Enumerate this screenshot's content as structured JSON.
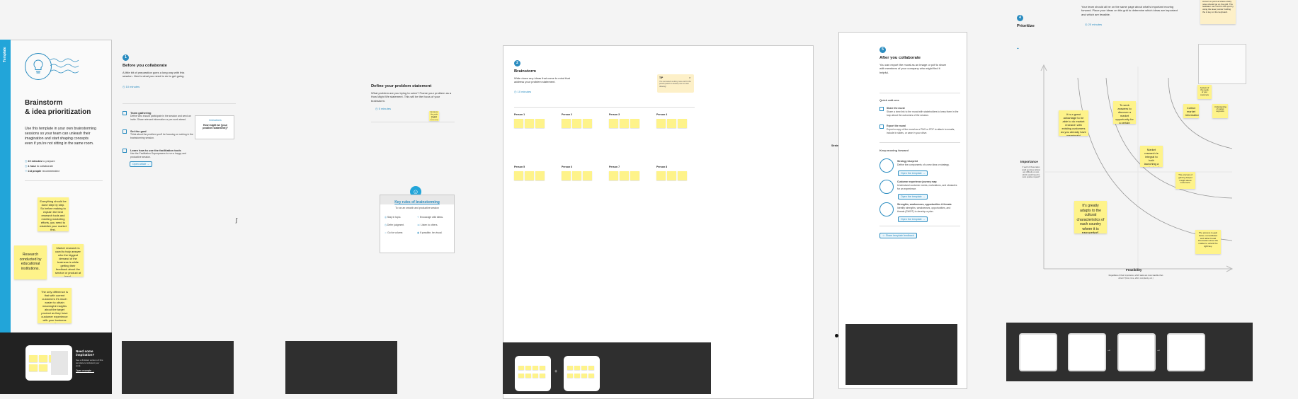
{
  "sidebar": {
    "tab_label": "Template",
    "title_line1": "Brainstorm",
    "title_line2": "& idea prioritization",
    "description": "Use this template in your own brainstorming sessions so your team can unleash their imagination and start shaping concepts even if you're not sitting in the same room.",
    "meta": [
      {
        "bold": "10 minutes",
        "rest": " to prepare"
      },
      {
        "bold": "1 hour",
        "rest": " to collaborate"
      },
      {
        "bold": "2-8 people",
        "rest": " recommended"
      }
    ],
    "stickies": [
      "Everything should be done step by step. So before making to explain the best research tools and meeting marketing efforts, you need to establish your market first.",
      "Research conducted by educational institutions.",
      "Market research is used to truly answer who the biggest demand of the business is while getting their feedback about the service or product at hand.",
      "The only difference is that with current customers it's much easier to obtain meaningful insights about the target product as they have customer experience with your business operations."
    ],
    "inspiration": {
      "title": "Need some inspiration?",
      "body": "See a finished version of this template to kickstart your work.",
      "button": "Open example"
    }
  },
  "step1": {
    "badge": "1",
    "title": "Before you collaborate",
    "body": "A little bit of preparation goes a long way with this session. Here's what you need to do to get going.",
    "time": "10 minutes",
    "items": [
      {
        "title": "Team gathering",
        "body": "Define who should participate in the session and send an invite. Share relevant information or pre-work ahead."
      },
      {
        "title": "Set the goal",
        "body": "Think about the problem you'll be focusing on solving in the brainstorming session."
      },
      {
        "title": "Learn how to use the facilitation tools",
        "body": "Use the Facilitation Superpowers to run a happy and productive session."
      }
    ],
    "open_article": "Open article",
    "card_label": "Instructions",
    "card_text": "How might we [your problem statement]?"
  },
  "step2": {
    "title": "Define your problem statement",
    "body": "What problem are you trying to solve? Frame your problem as a How Might We statement. This will be the focus of your brainstorm.",
    "time": "5 minutes",
    "sticky": "PROBLEM: How might we [your problem statement]?"
  },
  "rules": {
    "title": "Key rules of brainstorming",
    "subtitle": "To run an smooth and productive session",
    "items": [
      "Stay in topic.",
      "Defer judgment.",
      "Go for volume.",
      "Encourage wild ideas.",
      "Listen to others.",
      "If possible, be visual."
    ]
  },
  "brainstorm": {
    "badge": "2",
    "title": "Brainstorm",
    "body": "Write down any ideas that come to mind that address your problem statement.",
    "time": "10 minutes",
    "tip_label": "TIP",
    "tip_body": "You can select a sticky note and hit the pencil (switch to sketch) icon to start drawing!",
    "persons": [
      "Person 1",
      "Person 2",
      "Person 3",
      "Person 4",
      "Person 5",
      "Person 6",
      "Person 7",
      "Person 8"
    ]
  },
  "after": {
    "badge": "5",
    "title": "After you collaborate",
    "body": "You can export the mural as an image or pdf to share with members of your company who might find it helpful.",
    "quick_addons": "Quick add-ons",
    "addons": [
      {
        "title": "Share the mural",
        "body": "Share a view link to the mural with stakeholders to keep them in the loop about the outcomes of the session."
      },
      {
        "title": "Export the mural",
        "body": "Export a copy of the mural as a PNG or PDF to attach to emails, include in slides, or save in your drive."
      }
    ],
    "keep_moving": "Keep moving forward",
    "templates": [
      {
        "title": "Strategy blueprint",
        "body": "Define the components of a new idea or strategy.",
        "link": "Open the template"
      },
      {
        "title": "Customer experience journey map",
        "body": "Understand customer needs, motivations, and obstacles for an experience.",
        "link": "Open the template"
      },
      {
        "title": "Strengths, weaknesses, opportunities & threats",
        "body": "Identify strengths, weaknesses, opportunities, and threats (SWOT) to develop a plan.",
        "link": "Open the template"
      }
    ],
    "share_feedback": "Share template feedback",
    "strategy_label": "Strategy blueprint"
  },
  "prioritize": {
    "badge": "4",
    "title": "Prioritize",
    "intro": "Your team should all be on the same page about what's important moving forward. Place your ideas on this grid to determine which ideas are important and which are feasible.",
    "time": "20 minutes",
    "tip_sticky": "Participants can use their cursors to point at where sticky notes should go on the grid. The facilitator can confirm the spot by using the laser pointer holding the H key on the keyboard.",
    "importance_label": "Importance",
    "importance_note": "If each of these tasks could get done without any difficulty or cost, which would have the most positive impact?",
    "feasibility_label": "Feasibility",
    "feasibility_note": "Regardless of their importance, which tasks are more feasible than others? (Cost, time, effort, complexity, etc.)",
    "stickies": [
      "It is a great advantage to be able to do market research with existing customers as you already have meaningful interaction insights.",
      "To seek answers to discover a market opportunity for a certain business idea.",
      "Market research is integral to both launching a product and keeping it in the market.",
      "It's greatly adapts to the cultural characteristics of each country where it is presented.",
      "Collect market information",
      "Understanding of market segments",
      "Analysis of the needs of your customers",
      "The process to gain better, consolidated and rather broad information about the market to unlock the right key.",
      "The process of gaining deeper insight about customers."
    ]
  }
}
